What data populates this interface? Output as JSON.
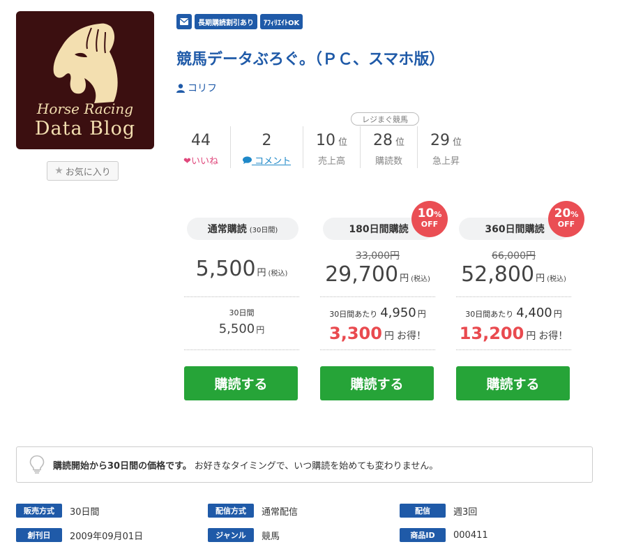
{
  "logo": {
    "line1": "Horse Racing",
    "line2": "Data Blog",
    "colors": {
      "bg": "#3b0f10",
      "ink": "#f3dfb0"
    }
  },
  "favorite": {
    "icon": "star-icon",
    "label": "お気に入り"
  },
  "tags": [
    "長期購読割引あり",
    "ｱﾌｨﾘｴｲﾄOK"
  ],
  "tag_icon": "mail-icon",
  "title": "競馬データぶろぐ。（ＰＣ、スマホ版）",
  "author": {
    "icon": "person-icon",
    "name": "コリフ"
  },
  "stats": {
    "likes": {
      "value": "44",
      "label": "いいね",
      "icon": "heart-icon"
    },
    "comments": {
      "value": "2",
      "label": "コメント",
      "icon": "speech-bubble-icon"
    },
    "rank_tab": "レジまぐ競馬",
    "rank_unit": "位",
    "sales": {
      "value": "10",
      "label": "売上高"
    },
    "subscribers": {
      "value": "28",
      "label": "購読数"
    },
    "rising": {
      "value": "29",
      "label": "急上昇"
    }
  },
  "plans": {
    "standard": {
      "name": "通常購読",
      "period": "(30日間)",
      "price": "5,500",
      "yen": "円",
      "tax": "(税込)",
      "per_label": "30日間",
      "per_price": "5,500",
      "button": "購読する"
    },
    "d180": {
      "name": "180日間購読",
      "badge_pct": "10",
      "badge_sign": "%",
      "badge_off": "OFF",
      "original": "33,000円",
      "price": "29,700",
      "yen": "円",
      "tax": "(税込)",
      "per_label": "30日間あたり",
      "per_price": "4,950",
      "save": "3,300",
      "save_suffix": "お得！",
      "button": "購読する"
    },
    "d360": {
      "name": "360日間購読",
      "badge_pct": "20",
      "badge_sign": "%",
      "badge_off": "OFF",
      "original": "66,000円",
      "price": "52,800",
      "yen": "円",
      "tax": "(税込)",
      "per_label": "30日間あたり",
      "per_price": "4,400",
      "save": "13,200",
      "save_suffix": "お得！",
      "button": "購読する"
    }
  },
  "notice": {
    "icon": "lightbulb-icon",
    "bold": "購読開始から30日間の価格です。",
    "text": "お好きなタイミングで、いつ購読を始めても変わりません。"
  },
  "meta": {
    "row1": [
      {
        "label": "販売方式",
        "value": "30日間"
      },
      {
        "label": "配信方式",
        "value": "通常配信"
      },
      {
        "label": "配信",
        "value": "週3回"
      }
    ],
    "row2": [
      {
        "label": "創刊日",
        "value": "2009年09月01日"
      },
      {
        "label": "ジャンル",
        "value": "競馬"
      },
      {
        "label": "商品ID",
        "value": "000411"
      }
    ]
  },
  "colors": {
    "brand": "#1f5aa8",
    "buy": "#26a438",
    "discount": "#ea4e54",
    "like": "#e0487c",
    "link": "#1e88c8"
  }
}
